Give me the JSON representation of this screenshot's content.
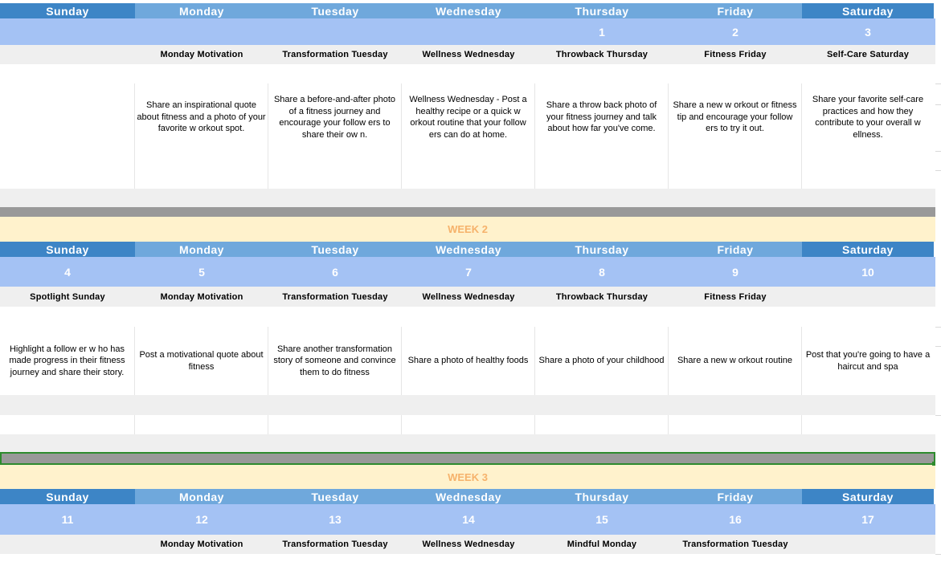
{
  "days": [
    "Sunday",
    "Monday",
    "Tuesday",
    "Wednesday",
    "Thursday",
    "Friday",
    "Saturday"
  ],
  "colors": {
    "header_dark": "#3d85c6",
    "header_light": "#6fa8dc",
    "number_row": "#a4c2f4",
    "theme_row": "#efefef",
    "week_band": "#fff2cc",
    "week_text": "#f6b26b",
    "separator": "#999999",
    "selection": "#2e8b2e"
  },
  "week1": {
    "numbers": [
      "",
      "",
      "",
      "",
      "1",
      "2",
      "3"
    ],
    "themes": [
      "",
      "Monday Motivation",
      "Transformation Tuesday",
      "Wellness Wednesday",
      "Throwback Thursday",
      "Fitness Friday",
      "Self-Care Saturday"
    ],
    "posts": [
      "",
      "Share an inspirational quote about fitness and a photo of your favorite w orkout spot.",
      "Share a before-and-after photo of a fitness journey and encourage your follow ers to share their ow n.",
      "Wellness Wednesday - Post a healthy recipe or a quick w orkout routine that your follow ers can do at home.",
      "Share a throw back photo of your fitness journey and talk about how far you've come.",
      "Share a new w orkout or fitness tip and encourage your follow ers to try it out.",
      "Share your favorite self-care practices and how they contribute to your overall w ellness."
    ]
  },
  "week2": {
    "label": "WEEK 2",
    "numbers": [
      "4",
      "5",
      "6",
      "7",
      "8",
      "9",
      "10"
    ],
    "themes": [
      "Spotlight Sunday",
      "Monday Motivation",
      "Transformation Tuesday",
      "Wellness Wednesday",
      "Throwback Thursday",
      "Fitness Friday",
      ""
    ],
    "posts": [
      "Highlight a follow er w ho has made progress in their fitness journey and share their story.",
      "Post a motivational quote about fitness",
      "Share another transformation story of someone and convince them to do fitness",
      "Share a photo of healthy foods",
      "Share a photo of your childhood",
      "Share a new w orkout routine",
      "Post that you're going to have a haircut and spa"
    ]
  },
  "week3": {
    "label": "WEEK 3",
    "numbers": [
      "11",
      "12",
      "13",
      "14",
      "15",
      "16",
      "17"
    ],
    "themes": [
      "",
      "Monday Motivation",
      "Transformation Tuesday",
      "Wellness Wednesday",
      "Mindful Monday",
      "Transformation Tuesday",
      ""
    ]
  }
}
